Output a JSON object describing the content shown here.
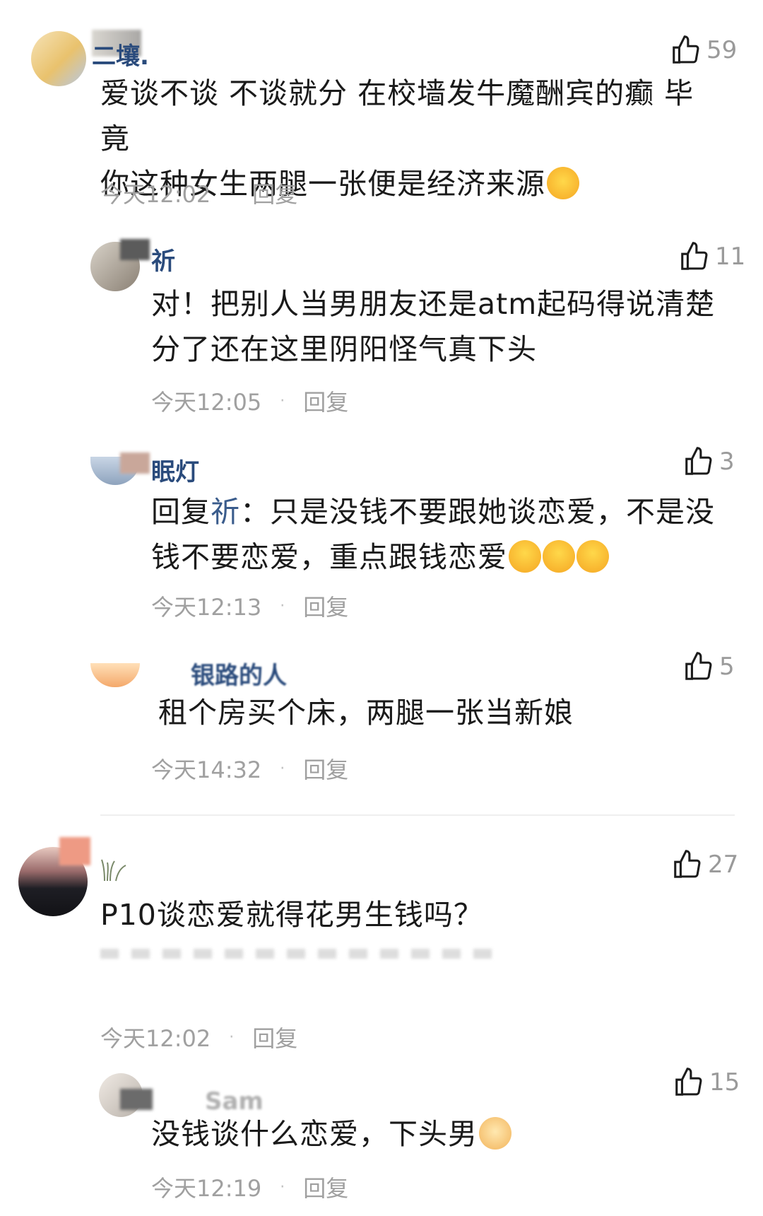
{
  "comments": [
    {
      "username": "二壤.",
      "likes": "59",
      "text_line1": "爱谈不谈 不谈就分 在校墙发牛魔酬宾的癫 毕竟",
      "text_line2": "你这种女生两腿一张便是经济来源",
      "time": "今天12:02",
      "reply": "回复"
    },
    {
      "username": "祈",
      "likes": "11",
      "text_line1": "对！把别人当男朋友还是atm起码得说清楚",
      "text_line2": "分了还在这里阴阳怪气真下头",
      "time": "今天12:05",
      "reply": "回复"
    },
    {
      "username": "眠灯",
      "likes": "3",
      "reply_prefix": "回复",
      "mention": "祈",
      "text_line1_rest": "：只是没钱不要跟她谈恋爱，不是没",
      "text_line2": "钱不要恋爱，重点跟钱恋爱",
      "time": "今天12:13",
      "reply": "回复"
    },
    {
      "username": "银路的人",
      "likes": "5",
      "text_line1": "租个房买个床，两腿一张当新娘",
      "time": "今天14:32",
      "reply": "回复"
    },
    {
      "username": "",
      "likes": "27",
      "text_line1": "P10谈恋爱就得花男生钱吗？",
      "time": "今天12:02",
      "reply": "回复"
    },
    {
      "username": "Sam",
      "likes": "15",
      "text_line1": "没钱谈什么恋爱，下头男",
      "time": "今天12:19",
      "reply": "回复"
    }
  ],
  "icons": {
    "like": "thumbs-up-outline-icon"
  },
  "colors": {
    "username": "#2a4b7c",
    "meta": "#a0a0a0",
    "text": "#1a1a1a"
  }
}
